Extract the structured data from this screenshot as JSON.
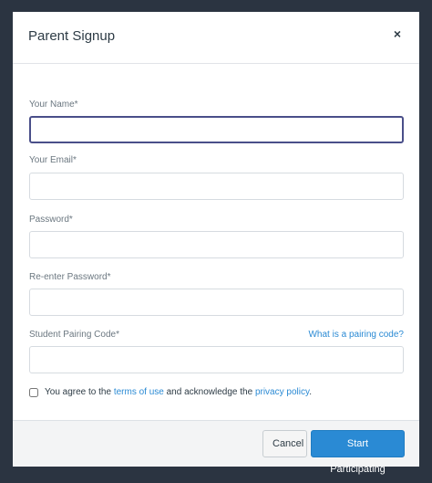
{
  "modal": {
    "title": "Parent Signup",
    "close_glyph": "×"
  },
  "form": {
    "name": {
      "label": "Your Name*",
      "value": ""
    },
    "email": {
      "label": "Your Email*",
      "value": ""
    },
    "password": {
      "label": "Password*",
      "value": ""
    },
    "confirm_password": {
      "label": "Re-enter Password*",
      "value": ""
    },
    "pairing_code": {
      "label": "Student Pairing Code*",
      "value": "",
      "help_link": "What is a pairing code?"
    },
    "agree": {
      "prefix": "You agree to the",
      "terms_link": "terms of use",
      "middle": "and acknowledge the",
      "privacy_link": "privacy policy",
      "suffix": "."
    }
  },
  "footer": {
    "cancel_label": "Cancel",
    "submit_label": "Start Participating"
  },
  "colors": {
    "backdrop": "#2b3441",
    "accent": "#2a8ad4",
    "focus_border": "#4a4f89"
  }
}
